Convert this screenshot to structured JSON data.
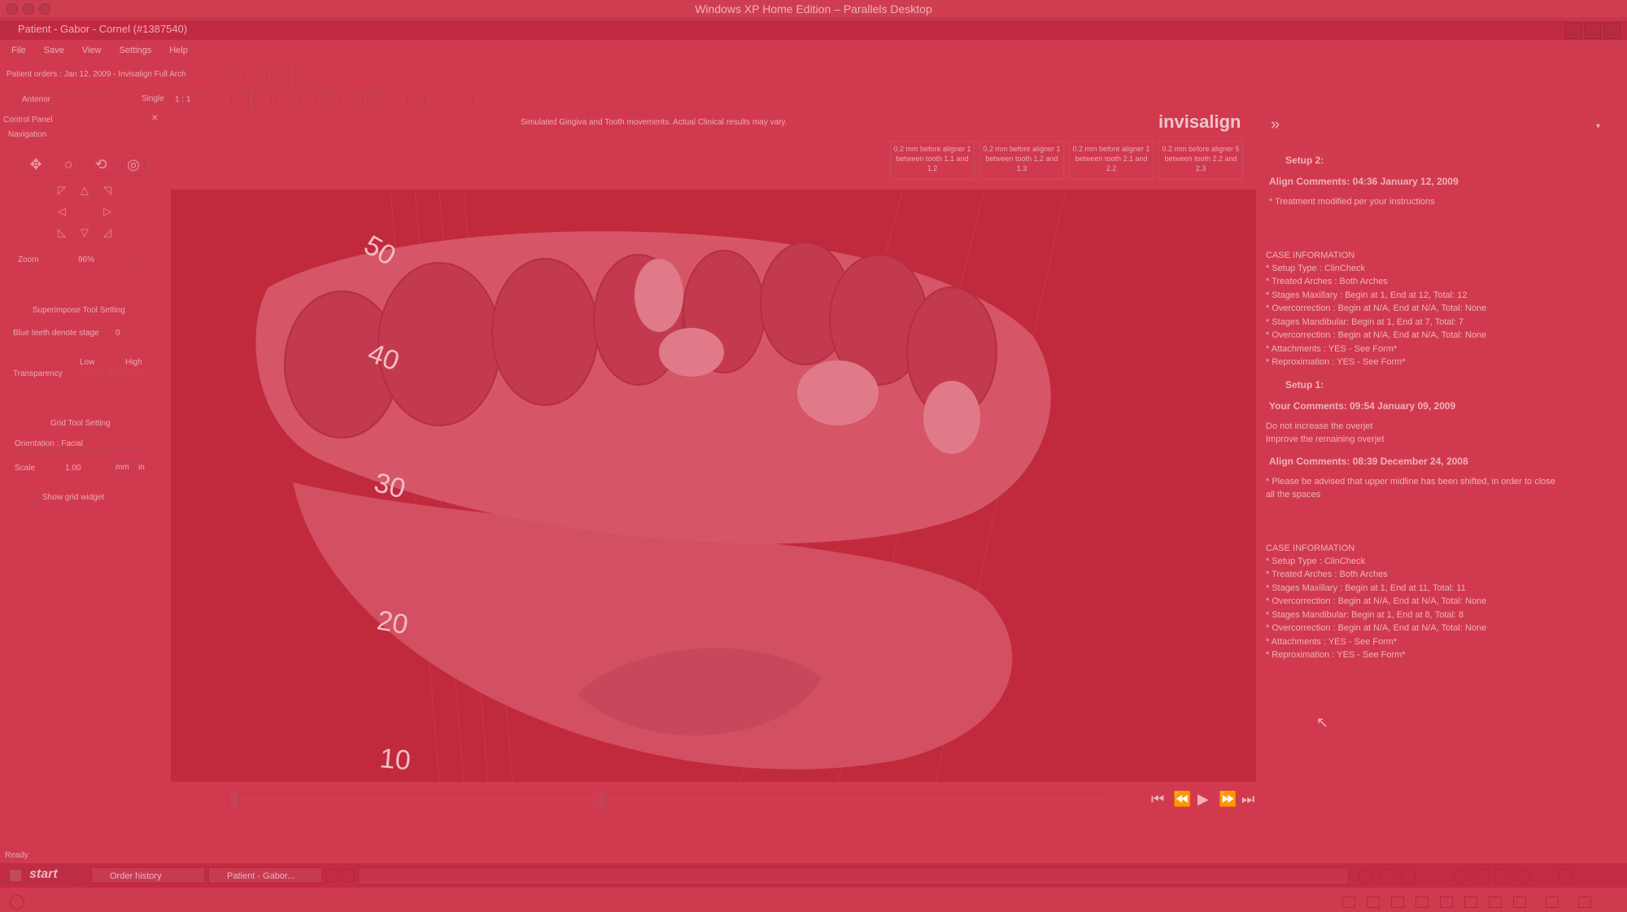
{
  "mac_window": {
    "title": "Windows XP Home Edition – Parallels Desktop"
  },
  "app_window": {
    "title": "Patient - Gabor - Cornel (#1387540)"
  },
  "menu": [
    "File",
    "Save",
    "View",
    "Settings",
    "Help"
  ],
  "toolbar1": {
    "patient_orders": "Patient orders : Jan 12, 2009 - Invisalign Full Arch"
  },
  "toolbar2": {
    "view_select": "Anterior",
    "display_label": "Single",
    "display_value": "1 : 1"
  },
  "control_panel": {
    "title": "Control Panel",
    "navigation_label": "Navigation",
    "zoom_label": "Zoom",
    "zoom_value": "96%",
    "superimpose_title": "Superimpose Tool Setting",
    "blue_teeth_label": "Blue teeth denote stage",
    "blue_teeth_value": "0",
    "low_label": "Low",
    "high_label": "High",
    "transparency_label": "Transparency",
    "grid_title": "Grid Tool Setting",
    "orientation_label": "Orientation",
    "orientation_value": "Facial",
    "scale_label": "Scale",
    "scale_value": "1.00",
    "unit_mm": "mm",
    "unit_in": "in",
    "show_grid_label": "Show grid widget"
  },
  "viewer": {
    "simulation_note": "Simulated Gingiva and Tooth movements. Actual Clinical results may vary.",
    "logo": "invisalign",
    "aligner_notes": [
      "0.2 mm before aligner 1 between tooth 1.1 and 1.2",
      "0.2 mm before aligner 1 between tooth 1.2 and 1.3",
      "0.2 mm before aligner 1 between tooth 2.1 and 2.2",
      "0.2 mm before aligner 5 between tooth 2.2 and 2.3"
    ],
    "ruler_labels": [
      "50",
      "40",
      "30",
      "20",
      "10"
    ]
  },
  "right_panel": {
    "setup2_title": "Setup 2:",
    "align_comments_1": "Align Comments: 04:36 January 12, 2009",
    "align_comments_1_text": "* Treatment modified per your instructions",
    "case_info_title": "CASE INFORMATION",
    "case_info_setup2": [
      "* Setup Type : ClinCheck",
      "* Treated Arches : Both Arches",
      "* Stages Maxillary : Begin at 1, End at 12, Total: 12",
      "* Overcorrection : Begin at N/A, End at N/A, Total: None",
      "* Stages Mandibular: Begin at 1, End at 7, Total: 7",
      "* Overcorrection : Begin at N/A, End at N/A, Total: None",
      "* Attachments : YES - See Form*",
      "* Reproximation : YES - See Form*"
    ],
    "setup1_title": "Setup 1:",
    "your_comments": "Your Comments: 09:54 January 09, 2009",
    "your_comments_text": [
      "Do not increase the overjet",
      "Improve the remaining overjet"
    ],
    "align_comments_2": "Align Comments: 08:39 December 24, 2008",
    "align_comments_2_text": [
      "* Please be advised that upper midline has been shifted, in order to close",
      "all the spaces"
    ],
    "case_info_setup1": [
      "* Setup Type : ClinCheck",
      "* Treated Arches : Both Arches",
      "* Stages Maxillary : Begin at 1, End at 11, Total: 11",
      "* Overcorrection : Begin at N/A, End at N/A, Total: None",
      "* Stages Mandibular: Begin at 1, End at 8, Total: 8",
      "* Overcorrection : Begin at N/A, End at N/A, Total: None",
      "* Attachments : YES - See Form*",
      "* Reproximation : YES - See Form*"
    ]
  },
  "status": {
    "text": "Ready"
  },
  "taskbar": {
    "start_label": "start",
    "tasks": [
      "Order history",
      "Patient - Gabor..."
    ]
  },
  "colors": {
    "overlay": "#d13a4e",
    "viewport": "#c02a3c"
  }
}
